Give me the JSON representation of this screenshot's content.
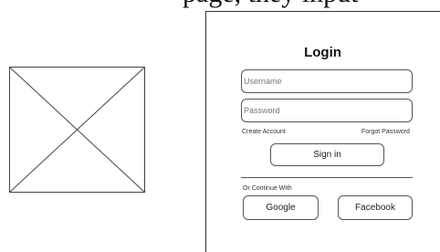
{
  "header": {
    "partial_text": "page, they input"
  },
  "login": {
    "title": "Login",
    "username_placeholder": "Username",
    "password_placeholder": "Password",
    "create_account_label": "Create Account",
    "forgot_password_label": "Forgot Password",
    "sign_in_label": "Sign in",
    "continue_with_label": "Or Continue With",
    "google_label": "Google",
    "facebook_label": "Facebook"
  },
  "icons": {
    "placeholder": "image-placeholder-icon"
  }
}
